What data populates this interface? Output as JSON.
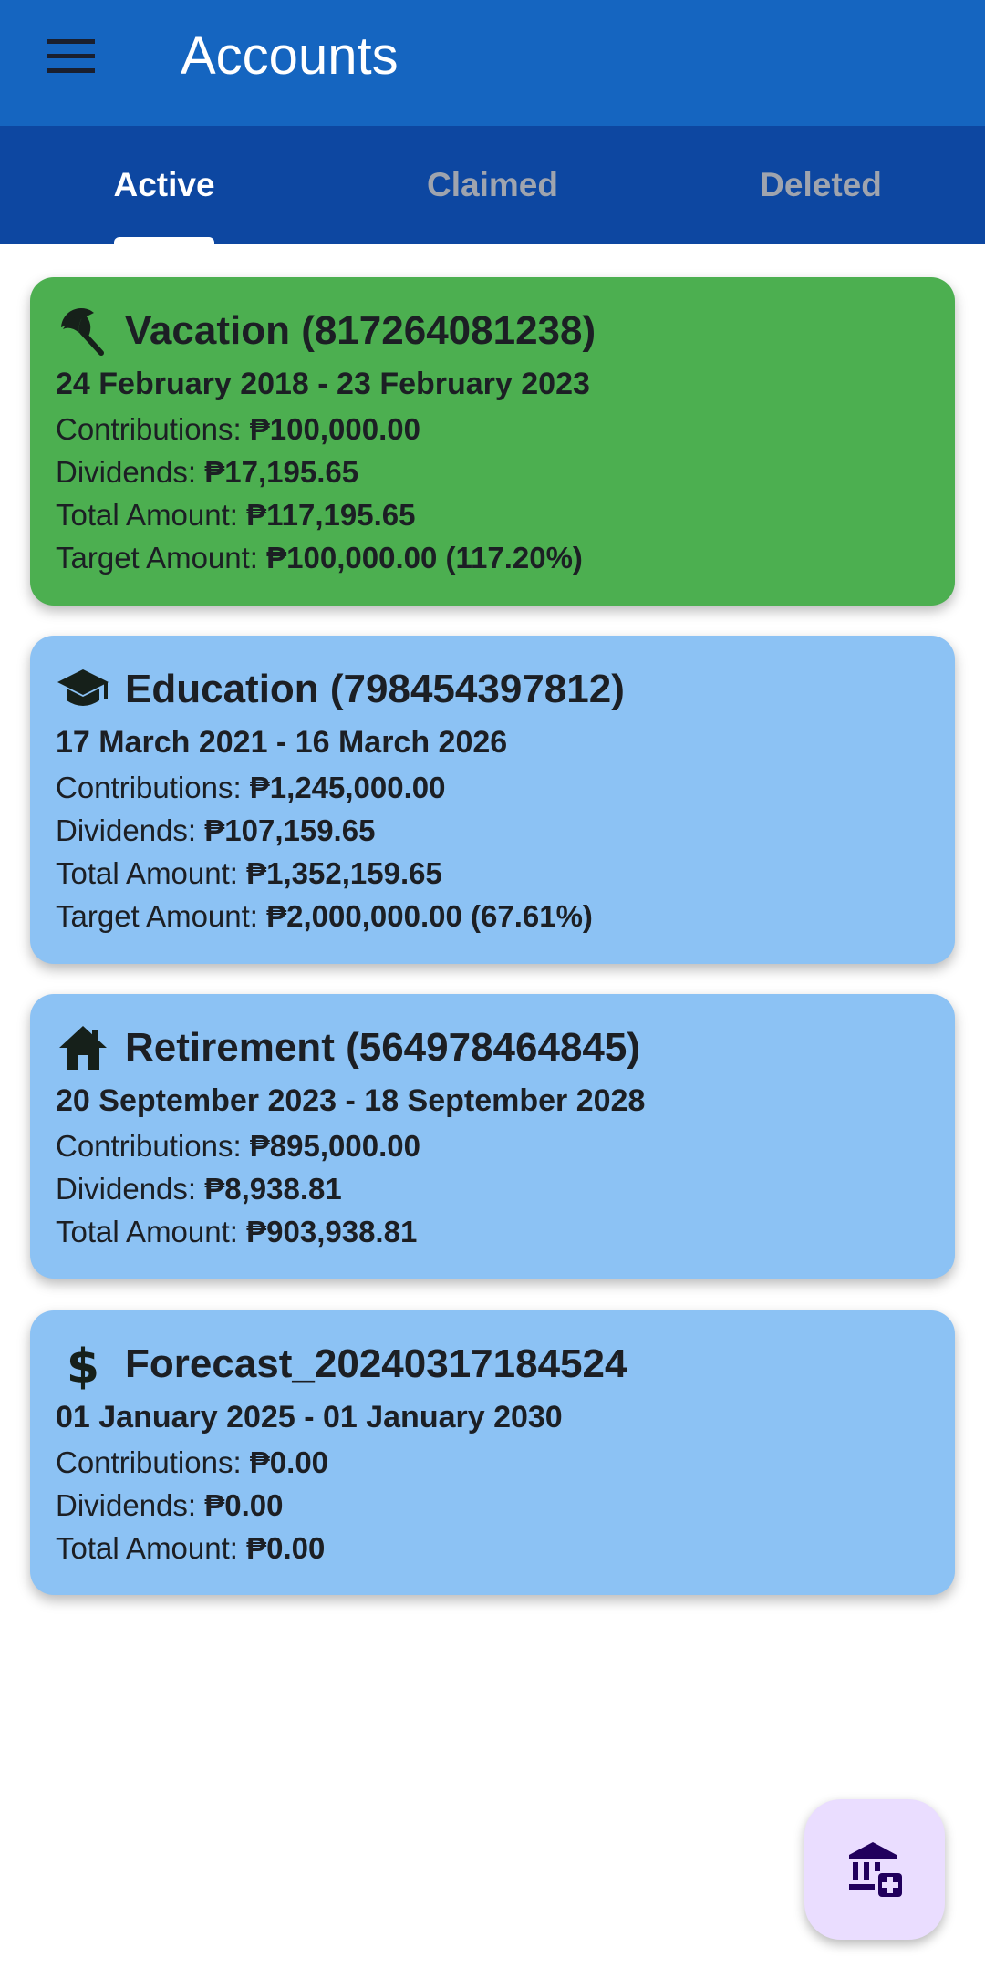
{
  "app_bar": {
    "title": "Accounts",
    "menu_icon": "menu-icon",
    "color": "#1565C0"
  },
  "tabs": [
    {
      "label": "Active",
      "selected": true
    },
    {
      "label": "Claimed",
      "selected": false
    },
    {
      "label": "Deleted",
      "selected": false
    }
  ],
  "accounts": [
    {
      "icon": "beach-umbrella-icon",
      "title": "Vacation (817264081238)",
      "date_range": "24 February 2018 - 23 February 2023",
      "contributions_label": "Contributions: ",
      "contributions": "₱100,000.00",
      "dividends_label": "Dividends: ",
      "dividends": "₱17,195.65",
      "total_label": "Total Amount: ",
      "total": "₱117,195.65",
      "target_label": "Target Amount: ",
      "target": "₱100,000.00 (117.20%)",
      "color": "#4CAF50"
    },
    {
      "icon": "graduation-cap-icon",
      "title": "Education (798454397812)",
      "date_range": "17 March 2021 - 16 March 2026",
      "contributions_label": "Contributions: ",
      "contributions": "₱1,245,000.00",
      "dividends_label": "Dividends: ",
      "dividends": "₱107,159.65",
      "total_label": "Total Amount: ",
      "total": "₱1,352,159.65",
      "target_label": "Target Amount: ",
      "target": "₱2,000,000.00 (67.61%)",
      "color": "#8CC2F4"
    },
    {
      "icon": "house-icon",
      "title": "Retirement (564978464845)",
      "date_range": "20 September 2023 - 18 September 2028",
      "contributions_label": "Contributions: ",
      "contributions": "₱895,000.00",
      "dividends_label": "Dividends: ",
      "dividends": "₱8,938.81",
      "total_label": "Total Amount: ",
      "total": "₱903,938.81",
      "color": "#8CC2F4"
    },
    {
      "icon": "dollar-icon",
      "title": "Forecast_20240317184524",
      "date_range": "01 January 2025 - 01 January 2030",
      "contributions_label": "Contributions: ",
      "contributions": "₱0.00",
      "dividends_label": "Dividends: ",
      "dividends": "₱0.00",
      "total_label": "Total Amount: ",
      "total": "₱0.00",
      "color": "#8CC2F4"
    }
  ],
  "fab": {
    "icon": "add-account-bank-icon",
    "color": "#EADDFF"
  }
}
